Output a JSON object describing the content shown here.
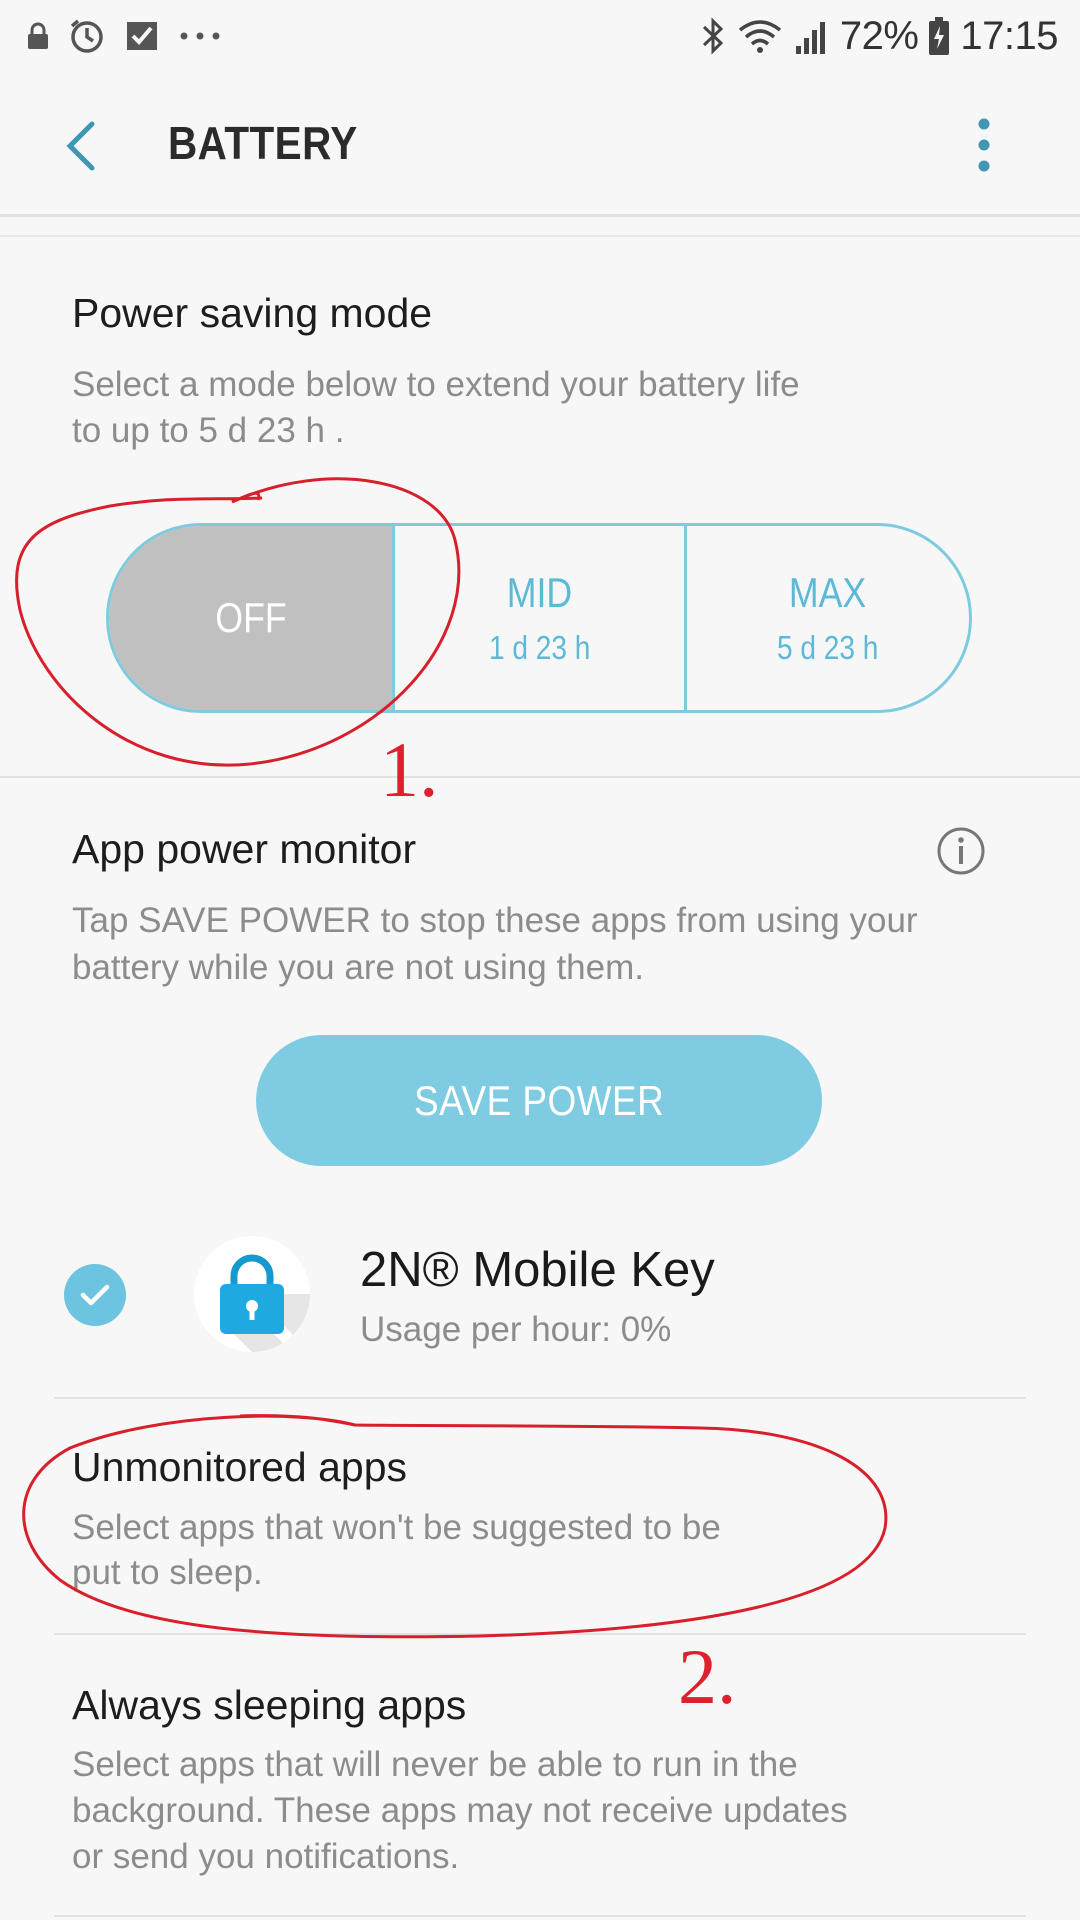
{
  "status_bar": {
    "battery_percent": "72%",
    "time": "17:15",
    "left_icons": [
      "lock-icon",
      "alarm-icon",
      "mail-check-icon",
      "more-dots-icon"
    ],
    "right_icons": [
      "bluetooth-icon",
      "wifi-icon",
      "signal-icon",
      "battery-charging-icon"
    ]
  },
  "app_bar": {
    "title": "BATTERY"
  },
  "power_saving": {
    "title": "Power saving mode",
    "desc_line1": "Select a mode below to extend your battery life",
    "desc_line2": "to up to 5 d 23 h .",
    "modes": [
      {
        "label": "OFF",
        "time": "",
        "selected": true
      },
      {
        "label": "MID",
        "time": "1 d 23 h",
        "selected": false
      },
      {
        "label": "MAX",
        "time": "5 d 23 h",
        "selected": false
      }
    ]
  },
  "app_power_monitor": {
    "title": "App power monitor",
    "desc_line1": "Tap SAVE POWER to stop these apps from using your",
    "desc_line2": "battery while you are not using them.",
    "button_label": "SAVE POWER",
    "apps": [
      {
        "name": "2N® Mobile Key",
        "usage": "Usage per hour: 0%",
        "checked": true
      }
    ]
  },
  "unmonitored": {
    "title": "Unmonitored apps",
    "desc_line1": "Select apps that won't be suggested to be",
    "desc_line2": "put to sleep."
  },
  "always_sleeping": {
    "title": "Always sleeping apps",
    "desc_line1": "Select apps that will never be able to run in the",
    "desc_line2": "background. These apps may not receive updates",
    "desc_line3": "or send you notifications."
  },
  "annotations": {
    "marker_1": "1.",
    "marker_2": "2."
  },
  "colors": {
    "accent": "#5cbad6",
    "button": "#7fcbe2",
    "selected_segment": "#c0c0c0",
    "annotation_red": "#e0202c"
  }
}
